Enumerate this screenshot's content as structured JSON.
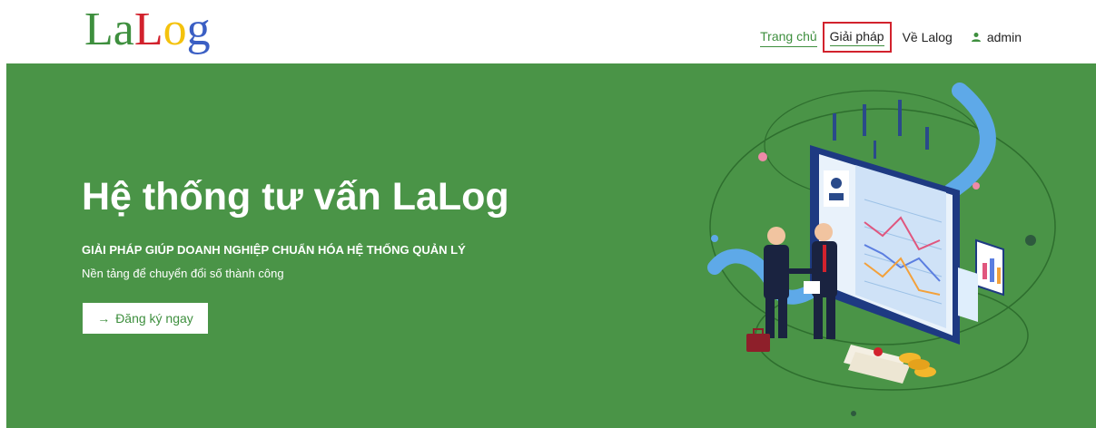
{
  "header": {
    "logo": {
      "letters": [
        {
          "char": "L",
          "color": "#3e8f3e"
        },
        {
          "char": "a",
          "color": "#3e8f3e"
        },
        {
          "char": "L",
          "color": "#d2222d"
        },
        {
          "char": "o",
          "color": "#f4c20d"
        },
        {
          "char": "g",
          "color": "#3b5fc4"
        }
      ]
    },
    "nav": {
      "home": "Trang chủ",
      "solutions": "Giải pháp",
      "about": "Về Lalog",
      "user": "admin"
    }
  },
  "hero": {
    "title": "Hệ thống tư vấn LaLog",
    "subtitle": "GIẢI PHÁP GIÚP DOANH NGHIỆP CHUẨN HÓA HỆ THỐNG QUẢN LÝ",
    "description": "Nền tảng để chuyển đổi số thành công",
    "cta_label": "Đăng ký ngay",
    "cta_icon": "arrow-right-icon"
  },
  "colors": {
    "brand_green": "#3e8f3e",
    "hero_bg": "#4a9447",
    "highlight_red": "#d2222d"
  }
}
